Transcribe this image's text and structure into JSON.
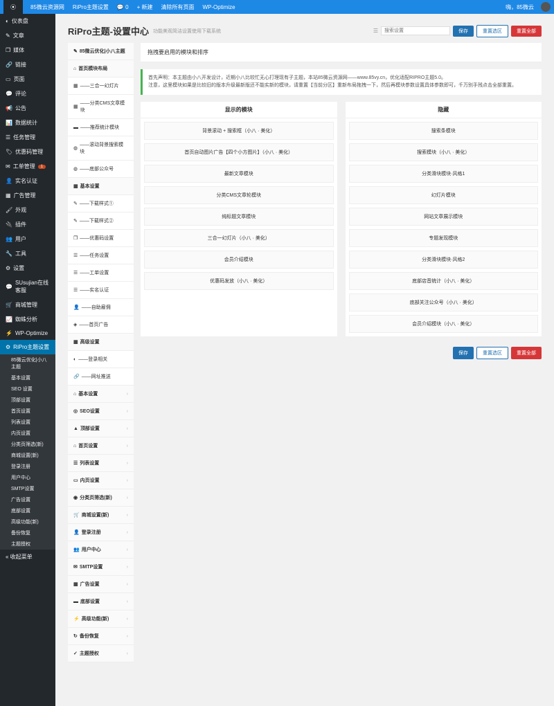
{
  "topbar": {
    "site": "85微云资源网",
    "theme": "RiPro主题设置",
    "comments": "0",
    "new": "+ 新建",
    "clear": "清除所有页面",
    "wpopt": "WP-Optimize",
    "greeting": "嗨，85微云"
  },
  "sidebar": {
    "items": [
      {
        "label": "仪表盘",
        "icon": "◐"
      },
      {
        "label": "文章",
        "icon": "✎"
      },
      {
        "label": "媒体",
        "icon": "❐"
      },
      {
        "label": "链接",
        "icon": "🔗"
      },
      {
        "label": "页面",
        "icon": "▭"
      },
      {
        "label": "评论",
        "icon": "💬"
      },
      {
        "label": "公告",
        "icon": "📢"
      },
      {
        "label": "数据统计",
        "icon": "📊"
      },
      {
        "label": "任务管理",
        "icon": "☰"
      },
      {
        "label": "优惠码管理",
        "icon": "🏷"
      },
      {
        "label": "工单管理",
        "icon": "✉",
        "badge": "1"
      },
      {
        "label": "实名认证",
        "icon": "👤"
      },
      {
        "label": "广告管理",
        "icon": "▦"
      },
      {
        "label": "外观",
        "icon": "🖌"
      },
      {
        "label": "插件",
        "icon": "🔌"
      },
      {
        "label": "用户",
        "icon": "👥"
      },
      {
        "label": "工具",
        "icon": "🔧"
      },
      {
        "label": "设置",
        "icon": "⚙"
      },
      {
        "label": "SUsujian在线客服",
        "icon": "💬"
      },
      {
        "label": "商城管理",
        "icon": "🛒"
      },
      {
        "label": "蜘蛛分析",
        "icon": "📈"
      },
      {
        "label": "WP-Optimize",
        "icon": "⚡"
      },
      {
        "label": "RiPro主题设置",
        "icon": "⚙",
        "active": true
      }
    ],
    "subs": [
      "85微云优化|小八主题",
      "基本设置",
      "SEO 设置",
      "顶部设置",
      "首页设置",
      "列表设置",
      "内页设置",
      "分类页筛选(新)",
      "商城设置(新)",
      "登录注册",
      "用户中心",
      "SMTP设置",
      "广告设置",
      "底部设置",
      "高级功能(新)",
      "备份恢复",
      "主题授权"
    ],
    "collapse": "« 收起菜单"
  },
  "page": {
    "title": "RiPro主题-设置中心",
    "subtitle": "功能美观简洁设置使用下载系统",
    "search_placeholder": "搜索设置",
    "save": "保存",
    "reset_section": "重置选区",
    "reset_all": "重置全部"
  },
  "nav": [
    {
      "label": "85微云优化|小八主题",
      "icon": "✎",
      "hl": true
    },
    {
      "label": "首页模块布局",
      "icon": "⌂",
      "hl": true
    },
    {
      "label": "——三合一幻灯片",
      "icon": "▦"
    },
    {
      "label": "——分类CMS文章模块",
      "icon": "▦"
    },
    {
      "label": "——推荐统计模块",
      "icon": "▬"
    },
    {
      "label": "——滚动背景搜索模块",
      "icon": "◍"
    },
    {
      "label": "——底部公众号",
      "icon": "◍"
    },
    {
      "label": "基本设置",
      "icon": "▦",
      "hl": true
    },
    {
      "label": "——下载样式①",
      "icon": "✎"
    },
    {
      "label": "——下载样式②",
      "icon": "✎"
    },
    {
      "label": "——优惠码设置",
      "icon": "❐"
    },
    {
      "label": "——任务设置",
      "icon": "☰"
    },
    {
      "label": "——工单设置",
      "icon": "☰"
    },
    {
      "label": "——实名认证",
      "icon": "☰"
    },
    {
      "label": "——自助雇佣",
      "icon": "👤"
    },
    {
      "label": "——首页广告",
      "icon": "◈"
    },
    {
      "label": "高级设置",
      "icon": "▦",
      "hl": true
    },
    {
      "label": "——登录相关",
      "icon": "◐"
    },
    {
      "label": "——网址推送",
      "icon": "🔗"
    },
    {
      "label": "基本设置",
      "icon": "⌂",
      "hl": true,
      "arrow": true
    },
    {
      "label": "SEO设置",
      "icon": "◎",
      "hl": true,
      "arrow": true
    },
    {
      "label": "顶部设置",
      "icon": "▲",
      "hl": true,
      "arrow": true
    },
    {
      "label": "首页设置",
      "icon": "⌂",
      "hl": true,
      "arrow": true
    },
    {
      "label": "列表设置",
      "icon": "☰",
      "hl": true,
      "arrow": true
    },
    {
      "label": "内页设置",
      "icon": "▭",
      "hl": true,
      "arrow": true
    },
    {
      "label": "分类页筛选(新)",
      "icon": "◉",
      "hl": true,
      "arrow": true
    },
    {
      "label": "商城设置(新)",
      "icon": "🛒",
      "hl": true,
      "arrow": true
    },
    {
      "label": "登录注册",
      "icon": "👤",
      "hl": true,
      "arrow": true
    },
    {
      "label": "用户中心",
      "icon": "👥",
      "hl": true,
      "arrow": true
    },
    {
      "label": "SMTP设置",
      "icon": "✉",
      "hl": true,
      "arrow": true
    },
    {
      "label": "广告设置",
      "icon": "▦",
      "hl": true,
      "arrow": true
    },
    {
      "label": "底部设置",
      "icon": "▬",
      "hl": true,
      "arrow": true
    },
    {
      "label": "高级功能(新)",
      "icon": "⚡",
      "hl": true,
      "arrow": true
    },
    {
      "label": "备份恢复",
      "icon": "↻",
      "hl": true,
      "arrow": true
    },
    {
      "label": "主题授权",
      "icon": "✓",
      "hl": true,
      "arrow": true
    }
  ],
  "content": {
    "drag_hint": "拖拽要启用的模块和排序",
    "notice_l1": "首先声明：本主题由小八开发设计，近期小八比较忙无心打理现有子主题，本站85微云资源网——www.85vy.cn，优化适配RIPRO主题5.0。",
    "notice_l2": "注意，这里模块如果是比较旧的版本升级最新版还不能实新的模块，请重置【当前分区】重新布局拖拽一下，然后再模块参数设置具体参数即可，千万别手残点击全部重置。",
    "show_header": "显示的模块",
    "hide_header": "隐藏",
    "show_items": [
      "背景滚动 + 搜索框（小八 · 美化）",
      "首页自动图片广告【四个小方图片】（小八 · 美化）",
      "最新文章模块",
      "分类CMS文章轮模块",
      "纯标题文章模块",
      "三合一幻灯片（小八 · 美化）",
      "会员介绍模块",
      "优惠码发放（小八 · 美化）"
    ],
    "hide_items": [
      "搜索条模块",
      "搜索模块（小八 · 美化）",
      "分类滑块模块·风格1",
      "幻灯片模块",
      "网站文章展示模块",
      "专题发现模块",
      "分类滑块模块·风格2",
      "底部店音统计（小八 · 美化）",
      "底部关注公众号（小八 · 美化）",
      "会员介绍模块（小八 · 美化）"
    ]
  }
}
